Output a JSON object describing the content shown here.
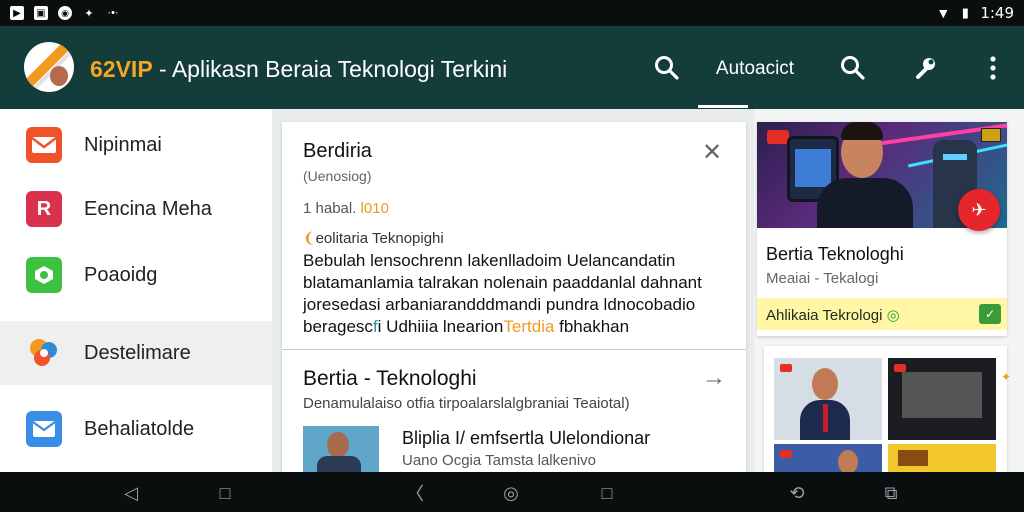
{
  "status_bar": {
    "time": "1:49",
    "left_icons": [
      "play-store-icon",
      "gallery-icon",
      "circle-app-icon",
      "bug-icon",
      "more-notifications-icon"
    ],
    "right_icons": [
      "wifi-icon",
      "battery-icon"
    ]
  },
  "app_bar": {
    "title_brand": "62VIP",
    "title_rest": " - Aplikasn Beraia Teknologi Terkini",
    "tab_label": "Autoacict",
    "colors": {
      "background": "#133c3a",
      "brand": "#f5a623"
    }
  },
  "drawer": {
    "items": [
      {
        "label": "Nipinmai",
        "icon": "mail-folder-icon",
        "color": "#f0522a",
        "glyph": "✉"
      },
      {
        "label": "Eencina Meha",
        "icon": "r-app-icon",
        "color": "#d8324f",
        "glyph": "R"
      },
      {
        "label": "Poaoidg",
        "icon": "green-app-icon",
        "color": "#3cc141",
        "glyph": "◈"
      },
      {
        "label": "Destelimare",
        "icon": "colorful-app-icon",
        "color": "#2f8bd8",
        "glyph": "✿"
      },
      {
        "label": "Behaliatolde",
        "icon": "envelope-icon",
        "color": "#3a8de6",
        "glyph": "✉"
      }
    ]
  },
  "article_card": {
    "title": "Berdiria",
    "subtitle": "(Uenosiog)",
    "meta_prefix": "1 habal. ",
    "meta_accent": "l010",
    "tag": "eolitaria Teknopighi",
    "body_line1": "Bebulah lensochrenn lakenlladoim Uelancandatin",
    "body_line2": "blatamanlamia talrakan nolenain paaddanlal dahnant",
    "body_line3": "joresedasi arbaniarandddmandi pundra ldnocobadio",
    "body_line4_a": "beragesc",
    "body_line4_b": "f",
    "body_line4_c": "i Udhiiia lnearion",
    "body_line4_d": "Tertdia",
    "body_line4_e": " fbhakhan"
  },
  "second_card": {
    "title": "Bertia - Teknologhi",
    "subtitle": "Denamulalaiso otfia tirpoalarslalgbraniai Teaiotal)",
    "row_title": "Bliplia I/ emfsertla Ulelondionar",
    "row_sub": "Uano Ocgia Tamsta lalkenivo"
  },
  "video_card": {
    "title": "Bertia Teknologhi",
    "subtitle": "Meaiai - Tekalogi",
    "banner": "Ahlikaia Tekrologi",
    "fab_glyph": "✈"
  },
  "nav_bar": {
    "buttons": [
      "back-icon",
      "recents-icon",
      "back-icon",
      "home-icon",
      "recents-icon",
      "rotate-icon",
      "screenshot-icon"
    ]
  }
}
